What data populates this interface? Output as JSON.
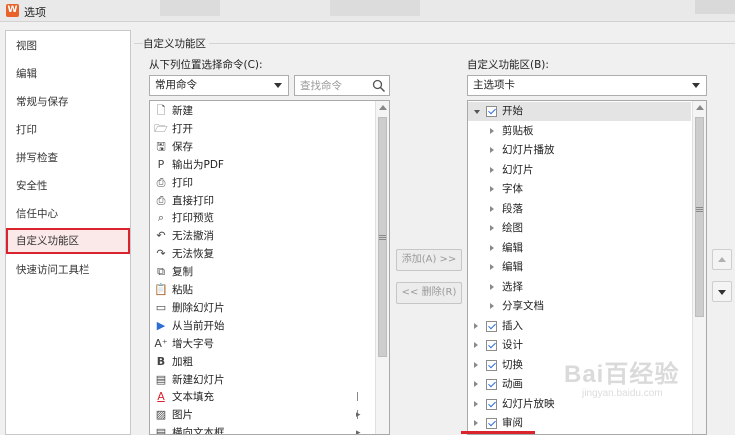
{
  "window": {
    "title": "选项",
    "logo_letter": "W"
  },
  "sidebar": {
    "items": [
      {
        "label": "视图"
      },
      {
        "label": "编辑"
      },
      {
        "label": "常规与保存"
      },
      {
        "label": "打印"
      },
      {
        "label": "拼写检查"
      },
      {
        "label": "安全性"
      },
      {
        "label": "信任中心"
      },
      {
        "label": "自定义功能区",
        "active": true
      },
      {
        "label": "快速访问工具栏"
      }
    ]
  },
  "panel": {
    "group_title": "自定义功能区",
    "left": {
      "label": "从下列位置选择命令(C):",
      "dropdown_value": "常用命令",
      "search_placeholder": "查找命令",
      "commands": [
        {
          "icon": "new-doc-icon",
          "glyph": "🗋",
          "label": "新建"
        },
        {
          "icon": "open-folder-icon",
          "glyph": "🗁",
          "label": "打开"
        },
        {
          "icon": "save-icon",
          "glyph": "🖫",
          "label": "保存"
        },
        {
          "icon": "export-pdf-icon",
          "glyph": "P",
          "label": "输出为PDF"
        },
        {
          "icon": "print-icon",
          "glyph": "⎙",
          "label": "打印"
        },
        {
          "icon": "direct-print-icon",
          "glyph": "⎙",
          "label": "直接打印"
        },
        {
          "icon": "print-preview-icon",
          "glyph": "⌕",
          "label": "打印预览"
        },
        {
          "icon": "undo-icon",
          "glyph": "↶",
          "label": "无法撤消"
        },
        {
          "icon": "redo-icon",
          "glyph": "↷",
          "label": "无法恢复"
        },
        {
          "icon": "copy-icon",
          "glyph": "⧉",
          "label": "复制"
        },
        {
          "icon": "paste-icon",
          "glyph": "📋",
          "label": "粘贴"
        },
        {
          "icon": "delete-slide-icon",
          "glyph": "▭",
          "label": "删除幻灯片"
        },
        {
          "icon": "play-from-current-icon",
          "glyph": "▶",
          "label": "从当前开始"
        },
        {
          "icon": "increase-font-icon",
          "glyph": "A⁺",
          "label": "增大字号"
        },
        {
          "icon": "bold-icon",
          "glyph": "B",
          "label": "加粗"
        },
        {
          "icon": "new-slide-icon",
          "glyph": "▤",
          "label": "新建幻灯片"
        },
        {
          "icon": "text-fill-icon",
          "glyph": "A",
          "label": "文本填充",
          "has_submenu": true
        },
        {
          "icon": "picture-icon",
          "glyph": "▨",
          "label": "图片",
          "has_submenu": true
        },
        {
          "icon": "textbox-icon",
          "glyph": "▤",
          "label": "横向文本框"
        }
      ],
      "submenu_glyph": "|▸"
    },
    "buttons": {
      "add": "添加(A) >>",
      "remove": "<< 删除(R)"
    },
    "right": {
      "label": "自定义功能区(B):",
      "dropdown_value": "主选项卡",
      "tree": [
        {
          "label": "开始",
          "level": 0,
          "expanded": true,
          "checked": true,
          "selected": true
        },
        {
          "label": "剪贴板",
          "level": 1
        },
        {
          "label": "幻灯片播放",
          "level": 1
        },
        {
          "label": "幻灯片",
          "level": 1
        },
        {
          "label": "字体",
          "level": 1
        },
        {
          "label": "段落",
          "level": 1
        },
        {
          "label": "绘图",
          "level": 1
        },
        {
          "label": "编辑",
          "level": 1
        },
        {
          "label": "编辑",
          "level": 1
        },
        {
          "label": "选择",
          "level": 1
        },
        {
          "label": "分享文档",
          "level": 1
        },
        {
          "label": "插入",
          "level": 0,
          "checked": true
        },
        {
          "label": "设计",
          "level": 0,
          "checked": true
        },
        {
          "label": "切换",
          "level": 0,
          "checked": true
        },
        {
          "label": "动画",
          "level": 0,
          "checked": true
        },
        {
          "label": "幻灯片放映",
          "level": 0,
          "checked": true
        },
        {
          "label": "审阅",
          "level": 0,
          "checked": true
        }
      ]
    }
  },
  "watermark": {
    "text": "Bai百经验",
    "url": "jingyan.baidu.com"
  },
  "colors": {
    "accent_red": "#d9232d",
    "checkbox_blue": "#2b6fd6",
    "brand_orange": "#e8622a"
  }
}
